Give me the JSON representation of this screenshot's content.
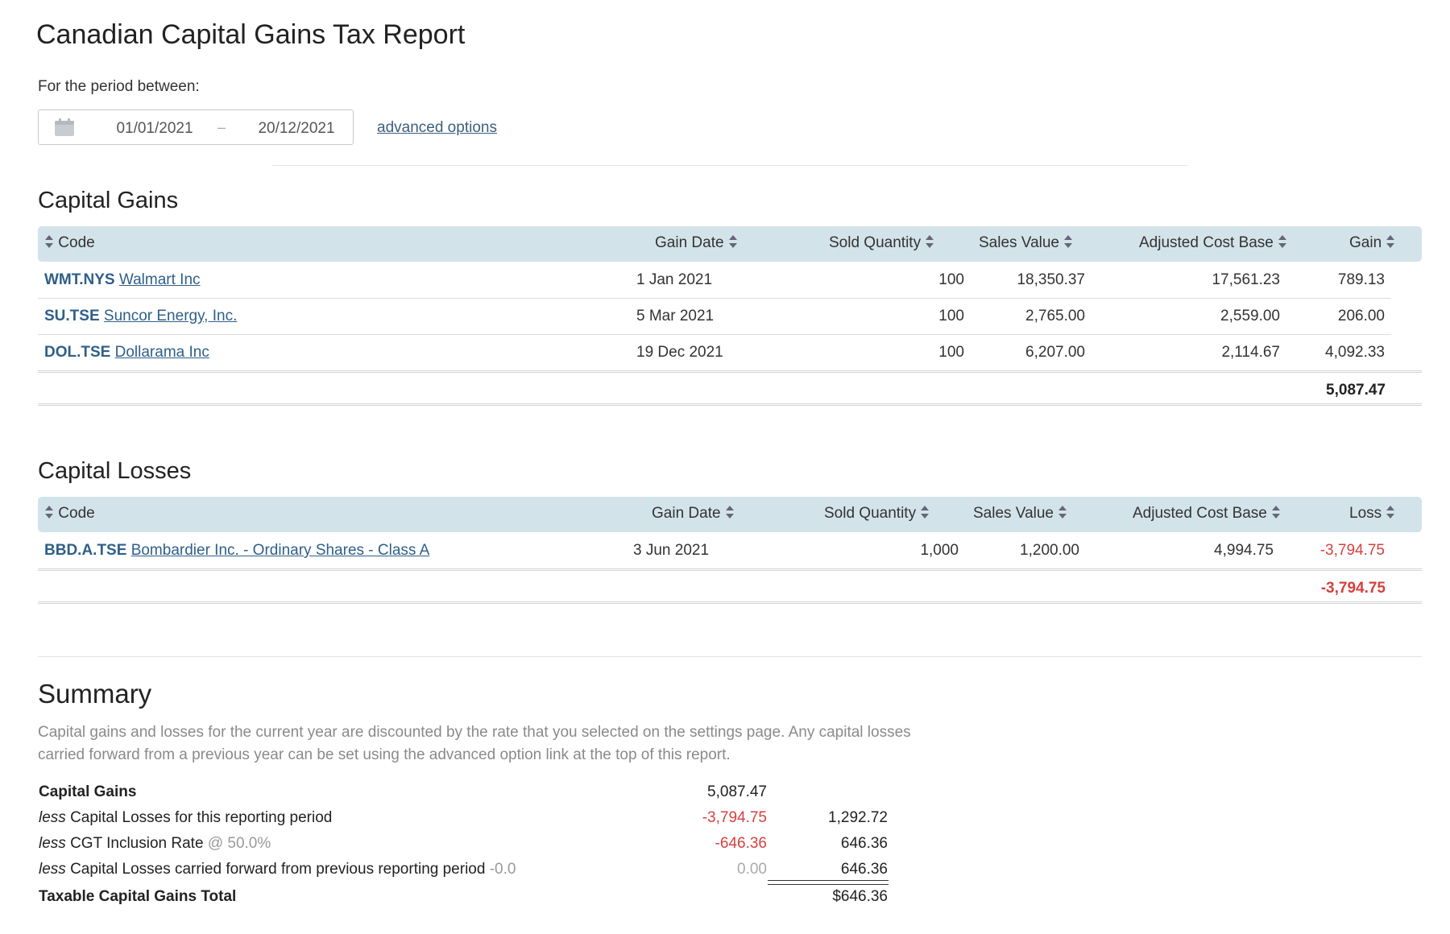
{
  "page": {
    "title": "Canadian Capital Gains Tax Report",
    "period_label": "For the period between:",
    "date_start": "01/01/2021",
    "date_separator": "–",
    "date_end": "20/12/2021",
    "advanced_link": "advanced options"
  },
  "gains": {
    "title": "Capital Gains",
    "headers": {
      "code": "Code",
      "date": "Gain Date",
      "qty": "Sold Quantity",
      "sales": "Sales Value",
      "acb": "Adjusted Cost Base",
      "result": "Gain"
    },
    "rows": [
      {
        "code": "WMT.NYS",
        "name": "Walmart Inc",
        "date": "1 Jan 2021",
        "qty": "100",
        "sales": "18,350.37",
        "acb": "17,561.23",
        "result": "789.13"
      },
      {
        "code": "SU.TSE",
        "name": "Suncor Energy, Inc.",
        "date": "5 Mar 2021",
        "qty": "100",
        "sales": "2,765.00",
        "acb": "2,559.00",
        "result": "206.00"
      },
      {
        "code": "DOL.TSE",
        "name": "Dollarama Inc",
        "date": "19 Dec 2021",
        "qty": "100",
        "sales": "6,207.00",
        "acb": "2,114.67",
        "result": "4,092.33"
      }
    ],
    "total": "5,087.47"
  },
  "losses": {
    "title": "Capital Losses",
    "headers": {
      "code": "Code",
      "date": "Gain Date",
      "qty": "Sold Quantity",
      "sales": "Sales Value",
      "acb": "Adjusted Cost Base",
      "result": "Loss"
    },
    "rows": [
      {
        "code": "BBD.A.TSE",
        "name": "Bombardier Inc. - Ordinary Shares - Class A",
        "date": "3 Jun 2021",
        "qty": "1,000",
        "sales": "1,200.00",
        "acb": "4,994.75",
        "result": "-3,794.75"
      }
    ],
    "total": "-3,794.75"
  },
  "summary": {
    "title": "Summary",
    "description": "Capital gains and losses for the current year are discounted by the rate that you selected on the settings page. Any capital losses carried forward from a previous year can be set using the advanced option link at the top of this report.",
    "capital_gains_label": "Capital Gains",
    "capital_gains_value": "5,087.47",
    "less_word": "less",
    "losses_label": "Capital Losses for this reporting period",
    "losses_value": "-3,794.75",
    "losses_running": "1,292.72",
    "inclusion_label": "CGT Inclusion Rate",
    "inclusion_rate": "@ 50.0%",
    "inclusion_value": "-646.36",
    "inclusion_running": "646.36",
    "carried_label": "Capital Losses carried forward from previous reporting period",
    "carried_rate": "-0.0",
    "carried_value": "0.00",
    "carried_running": "646.36",
    "total_label": "Taxable Capital Gains Total",
    "total_value": "$646.36"
  },
  "colors": {
    "header_bg": "#d3e3ea",
    "link": "#2f5f88",
    "negative": "#d64040"
  },
  "icons": {
    "date_picker": "calendar-icon",
    "sort": "sort-icon"
  }
}
